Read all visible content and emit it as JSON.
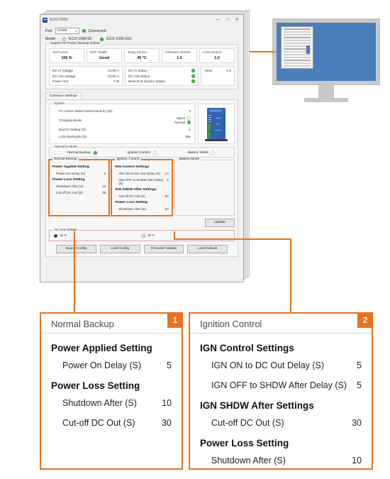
{
  "app": {
    "title": "ECO-1000",
    "window_buttons": [
      "—",
      "□",
      "✕"
    ],
    "port_label": "Port",
    "port_value": "COM4",
    "connection_status": "Connected",
    "model_label": "Model",
    "models": [
      {
        "label": "ECO-1000-05",
        "selected": false
      },
      {
        "label": "ECO-1000-10S",
        "selected": true
      }
    ],
    "supercap": {
      "group_title": "SuperCAP Power Backup Status",
      "cards": [
        {
          "title": "SCP Level",
          "value": "100 %"
        },
        {
          "title": "SCP Health",
          "value": "Good"
        },
        {
          "title": "Temp Sensor",
          "value": "45 °C"
        },
        {
          "title": "Firmware Version",
          "value": "1.0"
        },
        {
          "title": "LCM Version",
          "value": "1.0"
        }
      ],
      "voltages": [
        {
          "key": "DC In Voltage",
          "value": "23.99 V"
        },
        {
          "key": "DC Out Voltage",
          "value": "23.95 V"
        },
        {
          "key": "Power Out",
          "value": "7 W"
        }
      ],
      "statuses": [
        {
          "key": "DC In Status",
          "state": "on"
        },
        {
          "key": "DC Out Status",
          "state": "on"
        },
        {
          "key": "Back-End System Status",
          "state": "on"
        }
      ],
      "timer": {
        "key": "Timer",
        "value": "0 S"
      }
    },
    "tabs": [
      {
        "label": "Common Settings",
        "active": true
      }
    ],
    "system": {
      "title": "System",
      "rows": [
        {
          "key": "PC Active Status Determined by (W)",
          "value": "3"
        },
        {
          "key": "Buzzer Setting (S)",
          "value": "1"
        },
        {
          "key": "LCM BackLight (S)",
          "value": "999"
        }
      ],
      "charging_mode": {
        "key": "Charging Mode",
        "options": [
          {
            "label": "Quick",
            "selected": false
          },
          {
            "label": "Normal",
            "selected": true
          }
        ]
      }
    },
    "operation_mode": {
      "title": "Operation Mode",
      "options": [
        {
          "label": "Normal Backup",
          "selected": true
        },
        {
          "label": "Ignition Control",
          "selected": false
        },
        {
          "label": "Battery Mode",
          "selected": false
        }
      ]
    },
    "mode_panels": {
      "normal_backup": {
        "title": "Normal Backup",
        "groups": [
          {
            "heading": "Power Applied Setting",
            "rows": [
              {
                "key": "Power On Delay (S)",
                "value": "5"
              }
            ]
          },
          {
            "heading": "Power Loss Setting",
            "rows": [
              {
                "key": "Shutdown After (S)",
                "value": "10"
              },
              {
                "key": "Cut-off DC Out (S)",
                "value": "30"
              }
            ]
          }
        ]
      },
      "ignition_control": {
        "title": "Ignition Control",
        "groups": [
          {
            "heading": "IGN Control Settings",
            "rows": [
              {
                "key": "IGN ON to DC Out Delay (S)",
                "value": "10"
              },
              {
                "key": "IGN OFF to SHDW After Delay (S)",
                "value": "3"
              }
            ]
          },
          {
            "heading": "IGN SHDW After Settings",
            "rows": [
              {
                "key": "Cut-off DC Out (S)",
                "value": "30"
              }
            ]
          },
          {
            "heading": "Power Loss Setting",
            "rows": [
              {
                "key": "Shutdown After (S)",
                "value": "10"
              }
            ]
          }
        ]
      },
      "battery_mode": {
        "title": "Battery Mode"
      }
    },
    "update_button": "Update",
    "dc_out_voltage": {
      "title": "DC Out Voltage",
      "options": [
        {
          "label": "12 V",
          "selected": true
        },
        {
          "label": "24 V",
          "selected": false
        }
      ]
    },
    "bottom_buttons": [
      "Export Config",
      "Load Config",
      "Firmware Update",
      "Load Default"
    ]
  },
  "callouts": [
    {
      "badge": "1",
      "header": "Normal Backup",
      "sections": [
        {
          "heading": "Power Applied Setting",
          "rows": [
            {
              "key": "Power On Delay (S)",
              "value": "5"
            }
          ]
        },
        {
          "heading": "Power Loss Setting",
          "rows": [
            {
              "key": "Shutdown After (S)",
              "value": "10"
            },
            {
              "key": "Cut-off DC Out (S)",
              "value": "30"
            }
          ]
        }
      ]
    },
    {
      "badge": "2",
      "header": "Ignition Control",
      "sections": [
        {
          "heading": "IGN Control Settings",
          "rows": [
            {
              "key": "IGN ON to DC Out Delay (S)",
              "value": "5"
            },
            {
              "key": "IGN OFF to SHDW After Delay (S)",
              "value": "5"
            }
          ]
        },
        {
          "heading": "IGN SHDW After Settings",
          "rows": [
            {
              "key": "Cut-off DC Out (S)",
              "value": "30"
            }
          ]
        },
        {
          "heading": "Power Loss Setting",
          "rows": [
            {
              "key": "Shutdown After (S)",
              "value": "10"
            }
          ]
        }
      ]
    }
  ],
  "theme": {
    "accent": "#e8731c",
    "ok": "#3ec13e",
    "device": "#2f62b0"
  }
}
